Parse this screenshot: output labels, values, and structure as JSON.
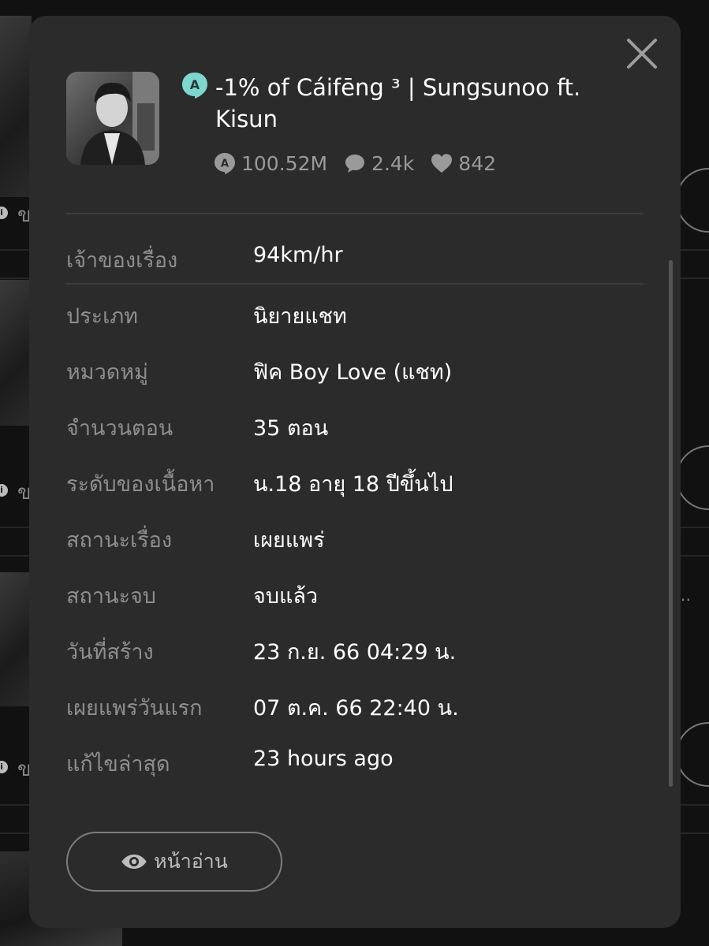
{
  "story": {
    "title": "-1% of Cáifēng ³ | Sungsunoo ft. Kisun",
    "stats": {
      "views": "100.52M",
      "comments": "2.4k",
      "likes": "842"
    }
  },
  "details": [
    {
      "label": "เจ้าของเรื่อง",
      "value": "94km/hr"
    },
    {
      "label": "ประเภท",
      "value": "นิยายแชท"
    },
    {
      "label": "หมวดหมู่",
      "value": "ฟิค Boy Love (แชท)"
    },
    {
      "label": "จำนวนตอน",
      "value": "35 ตอน"
    },
    {
      "label": "ระดับของเนื้อหา",
      "value": "น.18 อายุ 18 ปีขึ้นไป"
    },
    {
      "label": "สถานะเรื่อง",
      "value": "เผยแพร่"
    },
    {
      "label": "สถานะจบ",
      "value": "จบแล้ว"
    },
    {
      "label": "วันที่สร้าง",
      "value": "23 ก.ย. 66 04:29 น."
    },
    {
      "label": "เผยแพร่วันแรก",
      "value": "07 ต.ค. 66 22:40 น."
    },
    {
      "label": "แก้ไขล่าสุด",
      "value": "23 hours ago"
    }
  ],
  "actions": {
    "read_label": "หน้าอ่าน"
  },
  "background": {
    "row_letter": "ข"
  },
  "icons": {
    "close": "close-icon",
    "badge": "chat-badge-icon",
    "views": "views-icon",
    "comments": "comment-icon",
    "likes": "heart-icon",
    "read": "eye-icon"
  },
  "colors": {
    "modal_bg": "#2b2b2b",
    "badge": "#7fd6cf",
    "value_text": "#ffffff",
    "label_text": "#8e8e8e"
  }
}
